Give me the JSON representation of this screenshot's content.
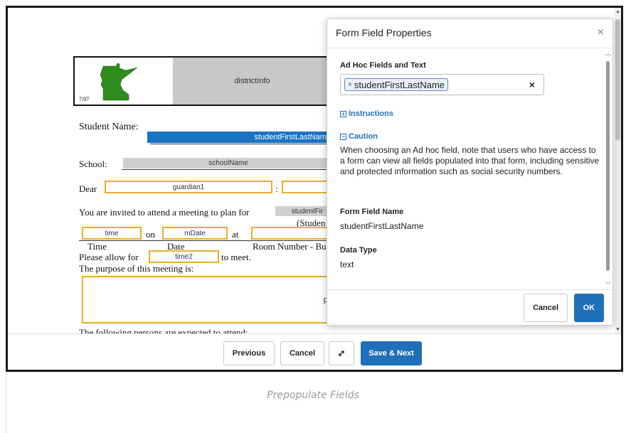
{
  "document": {
    "header": {
      "district_info": "districtInfo",
      "revision": "7/07"
    },
    "student_name_label": "Student Name:",
    "student_name_field": "studentFirstLastName",
    "school_label": "School:",
    "school_field": "schoolName",
    "dear_label": "Dear",
    "dear_field": "guardian1",
    "colon": ":",
    "invite_text": "You are invited to attend a meeting to plan for",
    "invite_field": "studentFir",
    "student_caption": "(Studen",
    "time_field": "time",
    "on_label": "on",
    "date_field": "mDate",
    "at_label": "at",
    "time_caption": "Time",
    "date_caption": "Date",
    "room_caption": "Room Number - Bu",
    "allow_label": "Please allow for",
    "time2_field": "time2",
    "to_meet": "to meet.",
    "purpose_label": "The purpose of this meeting is:",
    "purpose_field": "pu",
    "persons_label": "The following persons are expected to attend:"
  },
  "toolbar": {
    "previous": "Previous",
    "cancel": "Cancel",
    "expand_icon": "expand-icon",
    "save_next": "Save & Next"
  },
  "modal": {
    "title": "Form Field Properties",
    "close": "×",
    "adhoc_label": "Ad Hoc Fields and Text",
    "chip_value": "studentFirstLastName",
    "chip_remove": "×",
    "clear": "×",
    "instructions_link": "Instructions",
    "caution_link": "Caution",
    "caution_text": "When choosing an Ad hoc field, note that users who have access to a form can view all fields populated into that form, including sensitive and protected information such as social security numbers.",
    "field_name_label": "Form Field Name",
    "field_name_value": "studentFirstLastName",
    "data_type_label": "Data Type",
    "data_type_value": "text",
    "cancel": "Cancel",
    "ok": "OK"
  },
  "caption": "Prepopulate Fields",
  "colors": {
    "primary": "#1f6fbb",
    "field_orange": "#f0a92e",
    "field_grey": "#cfcfcf",
    "map_green": "#2e8b1e"
  }
}
